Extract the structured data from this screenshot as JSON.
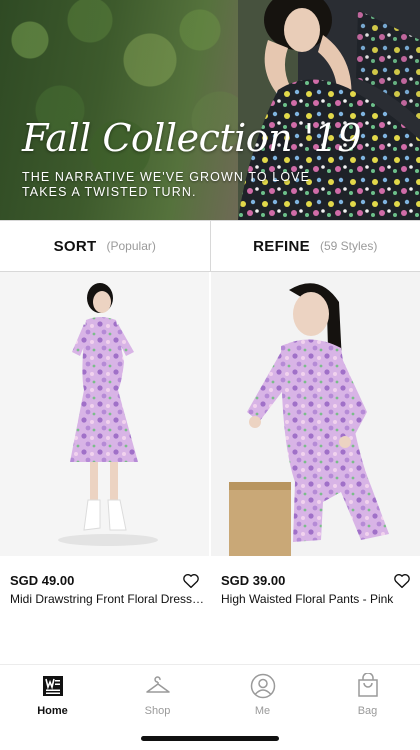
{
  "hero": {
    "headline": "Fall Collection '19",
    "tagline": "THE NARRATIVE WE'VE GROWN TO LOVE TAKES A TWISTED TURN."
  },
  "filters": {
    "sort_label": "SORT",
    "sort_value": "(Popular)",
    "refine_label": "REFINE",
    "refine_count": "(59 Styles)"
  },
  "products": [
    {
      "price": "SGD 49.00",
      "name": "Midi Drawstring Front Floral Dress - Pink"
    },
    {
      "price": "SGD 39.00",
      "name": "High Waisted Floral Pants - Pink"
    }
  ],
  "nav": {
    "items": [
      {
        "label": "Home",
        "icon": "home-newspaper-icon",
        "active": true
      },
      {
        "label": "Shop",
        "icon": "hanger-icon",
        "active": false
      },
      {
        "label": "Me",
        "icon": "user-circle-icon",
        "active": false
      },
      {
        "label": "Bag",
        "icon": "shopping-bag-icon",
        "active": false
      }
    ]
  },
  "colors": {
    "accent": "#111111",
    "muted": "#9a9a9a",
    "dress_pink": "#c9a0d8"
  }
}
